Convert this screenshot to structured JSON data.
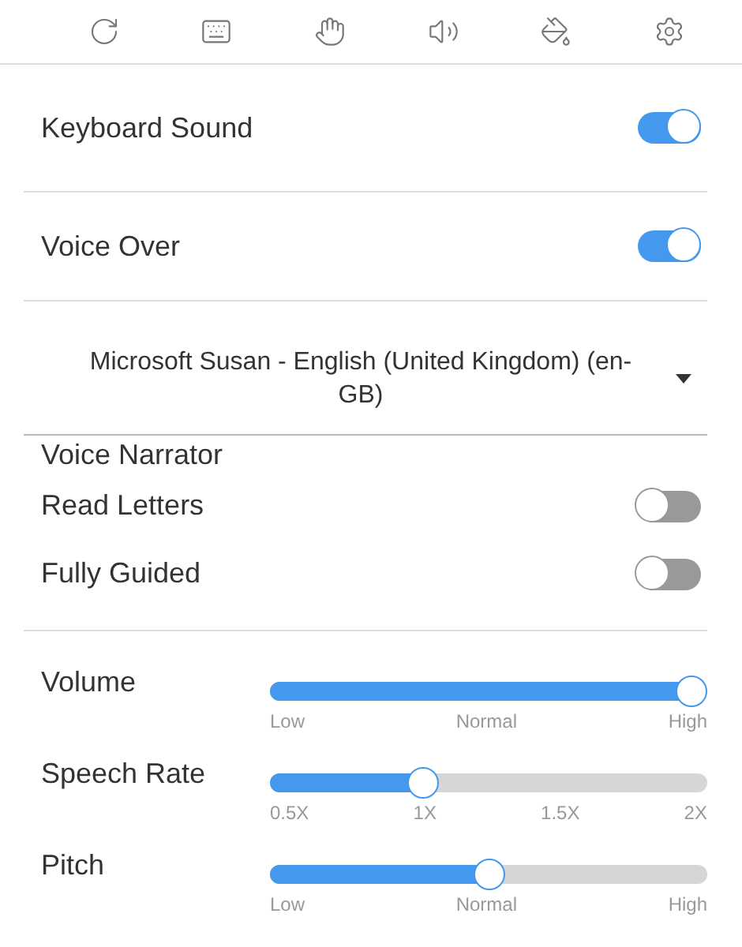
{
  "toolbar": [
    {
      "kind": "refresh"
    },
    {
      "kind": "keyboard"
    },
    {
      "kind": "hand"
    },
    {
      "kind": "speaker"
    },
    {
      "kind": "paint"
    },
    {
      "kind": "settings"
    }
  ],
  "top_toggles": [
    {
      "label": "Keyboard Sound",
      "on": true
    },
    {
      "label": "Voice Over",
      "on": true
    }
  ],
  "voice_select": {
    "value": "Microsoft Susan - English (United Kingdom) (en-GB)",
    "caption": "Voice Narrator"
  },
  "narrator_toggles": [
    {
      "label": "Read Letters",
      "on": false
    },
    {
      "label": "Fully Guided",
      "on": false
    }
  ],
  "sliders": [
    {
      "label": "Volume",
      "level": 1,
      "ticks": [
        "Low",
        "Normal",
        "High"
      ]
    },
    {
      "label": "Speech Rate",
      "level": 0.34,
      "ticks": [
        "0.5X",
        "1X",
        "1.5X",
        "2X"
      ]
    },
    {
      "label": "Pitch",
      "level": 0.5,
      "ticks": [
        "Low",
        "Normal",
        "High"
      ]
    }
  ]
}
